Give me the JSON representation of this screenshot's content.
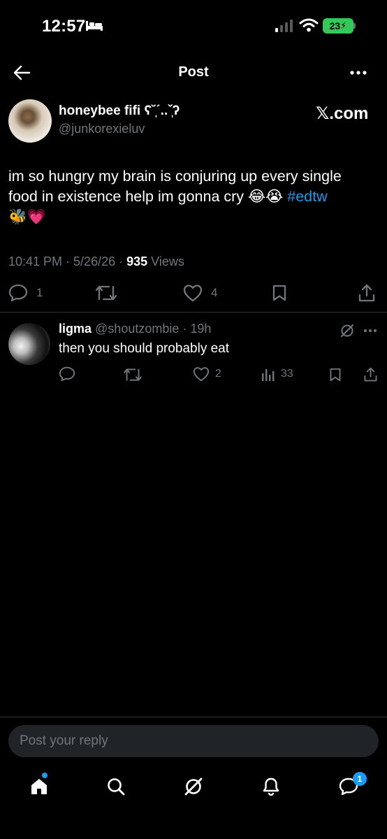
{
  "status_bar": {
    "time": "12:57",
    "battery": "23"
  },
  "header": {
    "title": "Post"
  },
  "post": {
    "author_name": "honeybee fifi ʕ˘̩ˊ..ˇ̩ʔ",
    "author_handle": "@junkorexieluv",
    "source": "𝕏.com",
    "text_line1": "im so hungry my brain is conjuring up every single",
    "text_line2": "food in existence help im gonna cry 😂😭 ",
    "hashtag": "#edtw",
    "text_line3": "🐝💗",
    "time": "10:41 PM",
    "date": "5/26/26",
    "views_count": "935",
    "views_label": "Views",
    "replies": "1",
    "likes": "4"
  },
  "reply": {
    "name": "ligma",
    "handle": "@shoutzombie",
    "age": "19h",
    "text": "then you should probably eat",
    "likes": "2",
    "views": "33"
  },
  "composer": {
    "placeholder": "Post your reply"
  },
  "bottom_nav": {
    "messages_badge": "1"
  },
  "colors": {
    "accent": "#1d9bf0",
    "muted": "#71767b",
    "divider": "#2f3336",
    "battery": "#34c759"
  }
}
